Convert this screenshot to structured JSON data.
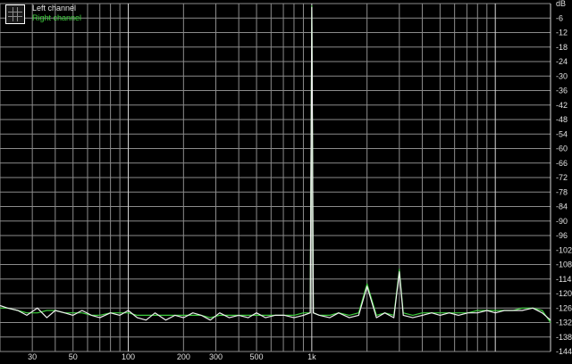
{
  "chart_data": {
    "type": "line",
    "title": "",
    "xlabel": "",
    "ylabel": "dB",
    "x_scale": "log",
    "xlim": [
      20,
      20000
    ],
    "ylim": [
      -144,
      0
    ],
    "x_ticks": [
      30,
      50,
      100,
      200,
      300,
      500,
      1000
    ],
    "x_tick_labels": [
      "30",
      "50",
      "100",
      "200",
      "300",
      "500",
      "1k"
    ],
    "y_ticks": [
      0,
      -6,
      -12,
      -18,
      -24,
      -30,
      -36,
      -42,
      -48,
      -54,
      -60,
      -66,
      -72,
      -78,
      -84,
      -90,
      -96,
      -102,
      -108,
      -114,
      -120,
      -126,
      -132,
      -138,
      -144
    ],
    "y_tick_labels": [
      "dB",
      "-6",
      "-12",
      "-18",
      "-24",
      "-30",
      "-36",
      "-42",
      "-48",
      "-54",
      "-60",
      "-66",
      "-72",
      "-78",
      "-84",
      "-90",
      "-96",
      "-102",
      "-108",
      "-114",
      "-120",
      "-126",
      "-132",
      "-138",
      "-144"
    ],
    "grid": true,
    "legend": "top-left",
    "series": [
      {
        "name": "Left channel",
        "color": "#f0f0f0",
        "x": [
          20,
          22,
          25,
          28,
          32,
          36,
          40,
          45,
          50,
          56,
          63,
          70,
          80,
          90,
          100,
          112,
          125,
          140,
          160,
          180,
          200,
          225,
          250,
          280,
          315,
          355,
          400,
          450,
          500,
          560,
          630,
          710,
          800,
          900,
          980,
          1000,
          1020,
          1100,
          1250,
          1400,
          1600,
          1800,
          2000,
          2250,
          2500,
          2800,
          3000,
          3150,
          3550,
          4000,
          4500,
          5000,
          5600,
          6300,
          7100,
          8000,
          9000,
          10000,
          11200,
          12500,
          14000,
          16000,
          18000,
          20000
        ],
        "y": [
          -125,
          -126,
          -127,
          -129,
          -126,
          -130,
          -127,
          -128,
          -129,
          -127,
          -129,
          -130,
          -128,
          -129,
          -127,
          -130,
          -131,
          -128,
          -131,
          -129,
          -130,
          -128,
          -129,
          -131,
          -128,
          -130,
          -129,
          -130,
          -128,
          -130,
          -129,
          -129,
          -130,
          -129,
          -128,
          -1.5,
          -128,
          -129,
          -130,
          -128,
          -130,
          -129,
          -117,
          -130,
          -128,
          -130,
          -111,
          -129,
          -130,
          -129,
          -128,
          -129,
          -128,
          -129,
          -128,
          -128,
          -127,
          -128,
          -127,
          -127,
          -127,
          -126,
          -128,
          -131
        ]
      },
      {
        "name": "Right channel",
        "color": "#3ecf3e",
        "x": [
          20,
          22,
          25,
          28,
          32,
          36,
          40,
          45,
          50,
          56,
          63,
          70,
          80,
          90,
          100,
          112,
          125,
          140,
          160,
          180,
          200,
          225,
          250,
          280,
          315,
          355,
          400,
          450,
          500,
          560,
          630,
          710,
          800,
          900,
          980,
          1000,
          1020,
          1100,
          1250,
          1400,
          1600,
          1800,
          2000,
          2250,
          2500,
          2800,
          3000,
          3150,
          3550,
          4000,
          4500,
          5000,
          5600,
          6300,
          7100,
          8000,
          9000,
          10000,
          11200,
          12500,
          14000,
          16000,
          18000,
          20000
        ],
        "y": [
          -126,
          -126,
          -127,
          -128,
          -128,
          -127,
          -127,
          -128,
          -128,
          -128,
          -129,
          -129,
          -128,
          -128,
          -128,
          -129,
          -129,
          -129,
          -129,
          -129,
          -129,
          -129,
          -129,
          -130,
          -129,
          -129,
          -129,
          -129,
          -129,
          -129,
          -129,
          -129,
          -129,
          -128,
          -128,
          -1.0,
          -128,
          -129,
          -129,
          -128,
          -129,
          -128,
          -116,
          -129,
          -128,
          -129,
          -110,
          -128,
          -129,
          -128,
          -128,
          -128,
          -128,
          -128,
          -128,
          -127,
          -127,
          -127,
          -127,
          -127,
          -126,
          -126,
          -127,
          -132
        ]
      }
    ]
  }
}
